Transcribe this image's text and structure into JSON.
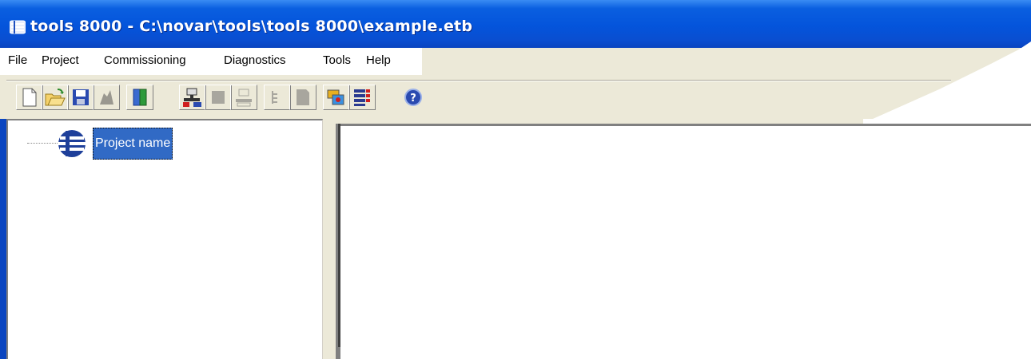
{
  "window": {
    "title": "tools 8000 - C:\\novar\\tools\\tools 8000\\example.etb",
    "icon": "app-icon"
  },
  "menu": {
    "items": [
      "File",
      "Project",
      "Commissioning",
      "Diagnostics",
      "Tools",
      "Help"
    ]
  },
  "toolbar": {
    "buttons": [
      {
        "name": "new-icon",
        "enabled": true
      },
      {
        "name": "open-icon",
        "enabled": true
      },
      {
        "name": "save-icon",
        "enabled": true
      },
      {
        "name": "disabled-icon",
        "enabled": false
      },
      {
        "name": "book-icon",
        "enabled": true
      },
      {
        "name": "network-icon",
        "enabled": true
      },
      {
        "name": "disabled-icon",
        "enabled": false
      },
      {
        "name": "disabled-icon",
        "enabled": false
      },
      {
        "name": "tree-icon",
        "enabled": false
      },
      {
        "name": "disabled-icon",
        "enabled": false
      },
      {
        "name": "palette-icon",
        "enabled": true
      },
      {
        "name": "list-icon",
        "enabled": true
      },
      {
        "name": "help-icon",
        "enabled": true
      }
    ]
  },
  "tree": {
    "root_label": "Project name"
  },
  "colors": {
    "titlebar": "#0454db",
    "selection": "#316ac5",
    "face": "#ece9d8"
  }
}
